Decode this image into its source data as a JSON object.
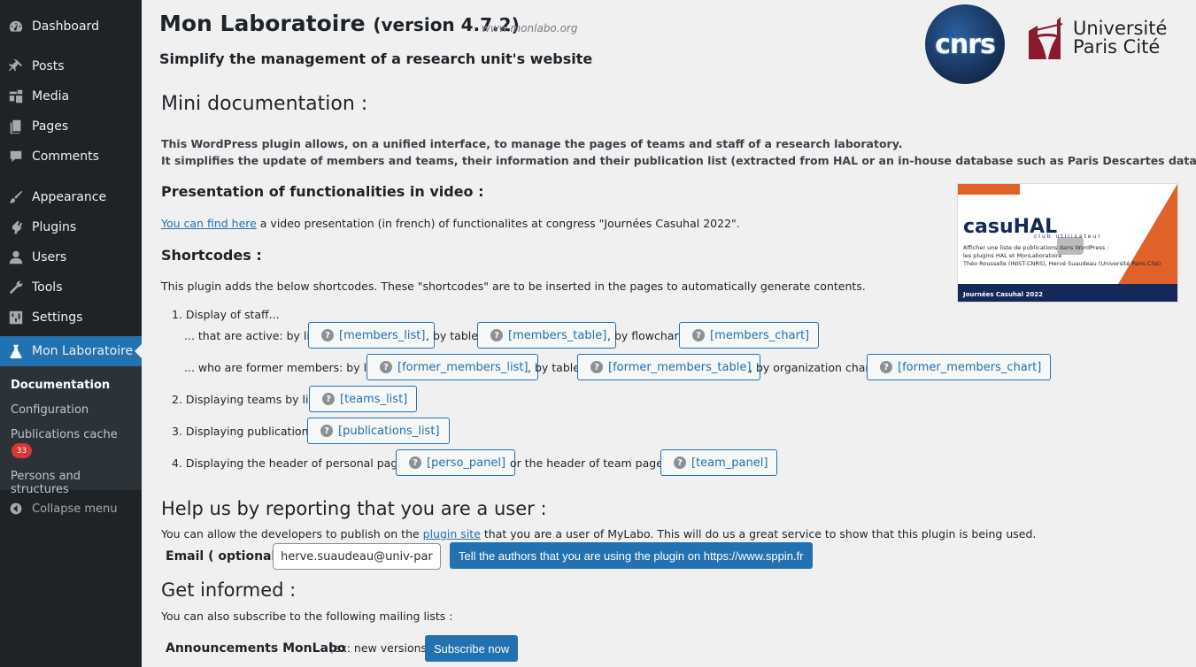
{
  "sidebar": {
    "items": [
      {
        "label": "Dashboard",
        "icon": "dashboard-icon"
      },
      {
        "label": "Posts",
        "icon": "pin-icon"
      },
      {
        "label": "Media",
        "icon": "media-icon"
      },
      {
        "label": "Pages",
        "icon": "pages-icon"
      },
      {
        "label": "Comments",
        "icon": "comment-icon"
      },
      {
        "label": "Appearance",
        "icon": "brush-icon"
      },
      {
        "label": "Plugins",
        "icon": "plugin-icon"
      },
      {
        "label": "Users",
        "icon": "user-icon"
      },
      {
        "label": "Tools",
        "icon": "wrench-icon"
      },
      {
        "label": "Settings",
        "icon": "settings-icon"
      },
      {
        "label": "Mon Laboratoire",
        "icon": "flask-icon",
        "active": true
      }
    ],
    "submenu": [
      {
        "label": "Documentation",
        "current": true
      },
      {
        "label": "Configuration"
      },
      {
        "label": "Publications cache",
        "badge": "33"
      },
      {
        "label": "Persons and structures"
      }
    ],
    "collapse_label": "Collapse menu"
  },
  "header": {
    "title": "Mon Laboratoire",
    "version": "(version 4.7.2)",
    "url": "www.monlabo.org",
    "subtitle": "Simplify the management of a research unit's website",
    "logo_cnrs": "cnrs",
    "logo_upc_line1": "Université",
    "logo_upc_line2": "Paris Cité"
  },
  "doc": {
    "title": "Mini documentation :",
    "intro1": "This WordPress plugin allows, on a unified interface, to manage the pages of teams and staff of a research laboratory.",
    "intro2": "It simplifies the update of members and teams, their information and their publication list (extracted from HAL or an in-house database such as Paris Descartes database).",
    "video_title": "Presentation of functionalities in video :",
    "video_link": "You can find here",
    "video_text": " a video presentation (in french) of functionalites at congress \"Journées Casuhal 2022\".",
    "video_thumb": {
      "brand": "casuHAL",
      "club": "club utilisateur",
      "line1": "Afficher une liste de publications dans WordPress :",
      "line2": "les plugins HAL et MonLaboratoire",
      "line3": "Théo Rousselle (INIST-CNRS), Hervé Suaudeau (Université Paris Cité)",
      "footer": "Journées Casuhal 2022"
    },
    "shortcodes_title": "Shortcodes :",
    "shortcodes_intro": "This plugin adds the below shortcodes. These \"shortcodes\" are to be inserted in the pages to automatically generate contents.",
    "list": {
      "item1": "1. Display of staff...",
      "active_prefix": "... that are active: by list",
      "by_table": ", by table",
      "by_flowchart": ", by flowchart",
      "former_prefix": "... who are former members: by list",
      "by_org_chart": ", by organization chart",
      "item2": "2. Displaying teams by list",
      "item3": "3. Displaying publications",
      "item4": "4. Displaying the header of personal pages",
      "or_team": "or the header of team pages"
    },
    "buttons": {
      "members_list": "[members_list]",
      "members_table": "[members_table]",
      "members_chart": "[members_chart]",
      "former_members_list": "[former_members_list]",
      "former_members_table": "[former_members_table]",
      "former_members_chart": "[former_members_chart]",
      "teams_list": "[teams_list]",
      "publications_list": "[publications_list]",
      "perso_panel": "[perso_panel]",
      "team_panel": "[team_panel]"
    }
  },
  "help": {
    "title": "Help us by reporting that you are a user :",
    "text_before": "You can allow the developers to publish on the ",
    "link": "plugin site",
    "text_after": " that you are a user of MyLabo. This will do us a great service to show that this plugin is being used.",
    "email_label": "Email ( optional )",
    "email_value": "herve.suaudeau@univ-paris-cite.fr",
    "submit": "Tell the authors that you are using the plugin on https://www.sppin.fr"
  },
  "informed": {
    "title": "Get informed :",
    "text": "You can also subscribe to the following mailing lists :",
    "list_name": "Announcements MonLabo",
    "list_note": "(ex: new versions)",
    "subscribe": "Subscribe now"
  }
}
